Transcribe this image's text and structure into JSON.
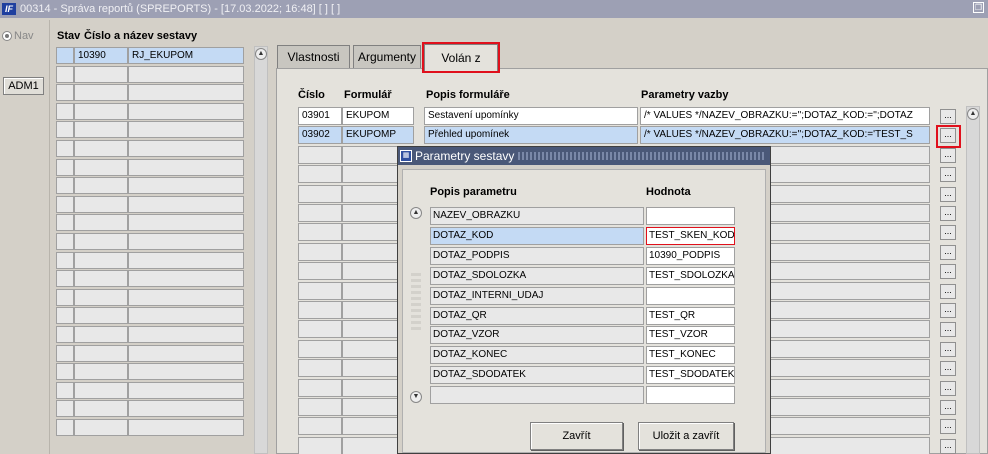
{
  "window": {
    "title": "00314 - Správa reportů (SPREPORTS) - [17.03.2022; 16:48]  [ ]  [ ]",
    "logo_text": "IF"
  },
  "left": {
    "nav_label": "Nav",
    "adm_button": "ADM1"
  },
  "reports": {
    "col_stav": "Stav",
    "col_name": "Číslo a název sestavy",
    "rows": [
      {
        "stav": "",
        "cislo": "10390",
        "nazev": "RJ_EKUPOM",
        "selected": true
      }
    ],
    "empty_rows": 20
  },
  "tabs": [
    {
      "label": "Vlastnosti",
      "active": false
    },
    {
      "label": "Argumenty",
      "active": false
    },
    {
      "label": "Volán z",
      "active": true
    }
  ],
  "called_from": {
    "col_cislo": "Číslo",
    "col_formular": "Formulář",
    "col_popis": "Popis formuláře",
    "col_parametry": "Parametry vazby",
    "rows": [
      {
        "cislo": "03901",
        "formular": "EKUPOM",
        "popis": "Sestavení upomínky",
        "parametry": "/* VALUES */NAZEV_OBRAZKU:='';DOTAZ_KOD:='';DOTAZ",
        "selected": false
      },
      {
        "cislo": "03902",
        "formular": "EKUPOMP",
        "popis": "Přehled upomínek",
        "parametry": "/* VALUES */NAZEV_OBRAZKU:='';DOTAZ_KOD:='TEST_S",
        "selected": true
      }
    ],
    "dots_label": "..."
  },
  "dialog": {
    "title": "Parametry sestavy",
    "col_popis": "Popis parametru",
    "col_hodnota": "Hodnota",
    "params": [
      {
        "name": "NAZEV_OBRAZKU",
        "value": "",
        "selected": false
      },
      {
        "name": "DOTAZ_KOD",
        "value": "TEST_SKEN_KOD",
        "selected": true
      },
      {
        "name": "DOTAZ_PODPIS",
        "value": "10390_PODPIS",
        "selected": false
      },
      {
        "name": "DOTAZ_SDOLOZKA",
        "value": "TEST_SDOLOZKA",
        "selected": false
      },
      {
        "name": "DOTAZ_INTERNI_UDAJ",
        "value": "",
        "selected": false
      },
      {
        "name": "DOTAZ_QR",
        "value": "TEST_QR",
        "selected": false
      },
      {
        "name": "DOTAZ_VZOR",
        "value": "TEST_VZOR",
        "selected": false
      },
      {
        "name": "DOTAZ_KONEC",
        "value": "TEST_KONEC",
        "selected": false
      },
      {
        "name": "DOTAZ_SDODATEK",
        "value": "TEST_SDODATEK",
        "selected": false
      },
      {
        "name": "",
        "value": "",
        "selected": false
      }
    ],
    "close_button": "Zavřít",
    "save_close_button": "Uložit a zavřít"
  },
  "colors": {
    "highlight": "#e0101c",
    "selection": "#c4daf4",
    "titlebar": "#9da0b4",
    "dialog_titlebar": "#4a5878"
  }
}
